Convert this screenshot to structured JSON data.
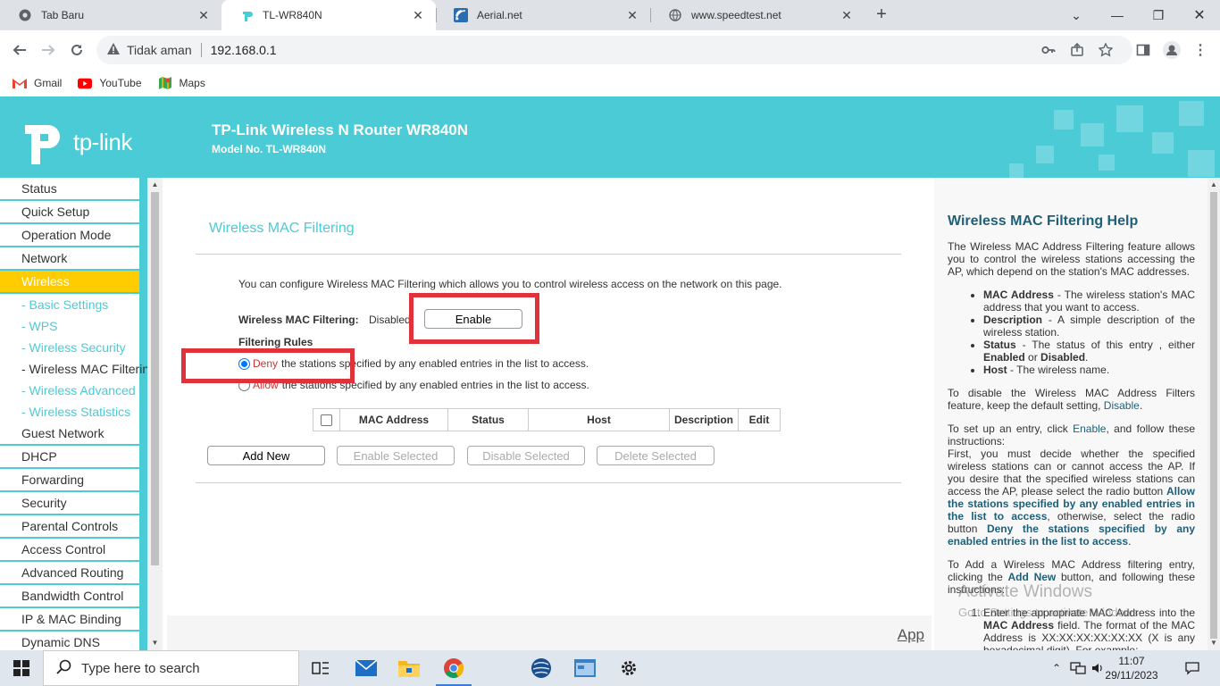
{
  "browser": {
    "tabs": [
      {
        "title": "Tab Baru",
        "icon": "chrome-icon"
      },
      {
        "title": "TL-WR840N",
        "icon": "tplink-icon"
      },
      {
        "title": "Aerial.net",
        "icon": "aerial-icon"
      },
      {
        "title": "www.speedtest.net",
        "icon": "globe-icon"
      }
    ],
    "security": "Tidak aman",
    "url": "192.168.0.1",
    "bookmarks": [
      {
        "label": "Gmail",
        "icon": "gmail-icon"
      },
      {
        "label": "YouTube",
        "icon": "youtube-icon"
      },
      {
        "label": "Maps",
        "icon": "maps-icon"
      }
    ]
  },
  "router": {
    "logo": "tp-link",
    "title": "TP-Link Wireless N Router WR840N",
    "model": "Model No. TL-WR840N",
    "menu": [
      {
        "label": "Status",
        "type": "main"
      },
      {
        "label": "Quick Setup",
        "type": "main"
      },
      {
        "label": "Operation Mode",
        "type": "main"
      },
      {
        "label": "Network",
        "type": "main"
      },
      {
        "label": "Wireless",
        "type": "active"
      },
      {
        "label": "- Basic Settings",
        "type": "sub"
      },
      {
        "label": "- WPS",
        "type": "sub"
      },
      {
        "label": "- Wireless Security",
        "type": "sub"
      },
      {
        "label": "- Wireless MAC Filtering",
        "type": "current"
      },
      {
        "label": "- Wireless Advanced",
        "type": "sub"
      },
      {
        "label": "- Wireless Statistics",
        "type": "sub"
      },
      {
        "label": "Guest Network",
        "type": "main"
      },
      {
        "label": "DHCP",
        "type": "main"
      },
      {
        "label": "Forwarding",
        "type": "main"
      },
      {
        "label": "Security",
        "type": "main"
      },
      {
        "label": "Parental Controls",
        "type": "main"
      },
      {
        "label": "Access Control",
        "type": "main"
      },
      {
        "label": "Advanced Routing",
        "type": "main"
      },
      {
        "label": "Bandwidth Control",
        "type": "main"
      },
      {
        "label": "IP & MAC Binding",
        "type": "main"
      },
      {
        "label": "Dynamic DNS",
        "type": "main"
      }
    ]
  },
  "content": {
    "page_title": "Wireless MAC Filtering",
    "intro": "You can configure Wireless MAC Filtering which allows you to control wireless access on the network on this page.",
    "filter_label": "Wireless MAC Filtering:",
    "filter_status": "Disabled",
    "enable_btn": "Enable",
    "rules_label": "Filtering Rules",
    "deny_kw": "Deny",
    "deny_text": "the stations specified by any enabled entries in the list to access.",
    "allow_kw": "Allow",
    "allow_text": "the stations specified by any enabled entries in the list to access.",
    "table_headers": [
      "MAC Address",
      "Status",
      "Host",
      "Description",
      "Edit"
    ],
    "buttons": {
      "add_new": "Add New",
      "enable_selected": "Enable Selected",
      "disable_selected": "Disable Selected",
      "delete_selected": "Delete Selected"
    },
    "apply": "App"
  },
  "help": {
    "title": "Wireless MAC Filtering Help",
    "p1": "The Wireless MAC Address Filtering feature allows you to control the wireless stations accessing the AP, which depend on the station's MAC addresses.",
    "items": [
      {
        "term": "MAC Address",
        "desc": " - The wireless station's MAC address that you want to access."
      },
      {
        "term": "Description",
        "desc": " - A simple description of the wireless station."
      },
      {
        "term": "Status",
        "desc": " - The status of this entry , either "
      },
      {
        "term": "Host",
        "desc": " - The wireless name."
      }
    ],
    "status_enabled": "Enabled",
    "status_or": " or ",
    "status_disabled": "Disabled",
    "p2_a": "To disable the Wireless MAC Address Filters feature, keep the default setting, ",
    "p2_link": "Disable",
    "p3_a": "To set up an entry, click ",
    "p3_link": "Enable",
    "p3_b": ", and follow these instructions:",
    "p4_a": "First, you must decide whether the specified wireless stations can or cannot access the AP. If you desire that the specified wireless stations can access the AP, please select the radio button ",
    "p4_allow": "Allow the stations specified by any enabled entries in the list to access",
    "p4_b": ", otherwise, select the radio button ",
    "p4_deny": "Deny the stations specified by any enabled entries in the list to access",
    "p5_a": "To Add a Wireless MAC Address filtering entry, clicking the ",
    "p5_link": "Add New",
    "p5_b": " button, and following these instructions:",
    "step1_a": "Enter the appropriate MAC Address into the ",
    "step1_b": "MAC Address",
    "step1_c": " field. The format of the MAC Address is XX:XX:XX:XX:XX:XX (X is any hexadecimal digit). For example:"
  },
  "watermark": {
    "line1": "Activate Windows",
    "line2": "Go to Settings to activate Windows."
  },
  "taskbar": {
    "search_placeholder": "Type here to search",
    "time": "11:07",
    "date": "29/11/2023"
  },
  "colors": {
    "brand": "#4acbd6",
    "menu_active": "#ffcc00",
    "highlight_box": "#e0323a"
  }
}
